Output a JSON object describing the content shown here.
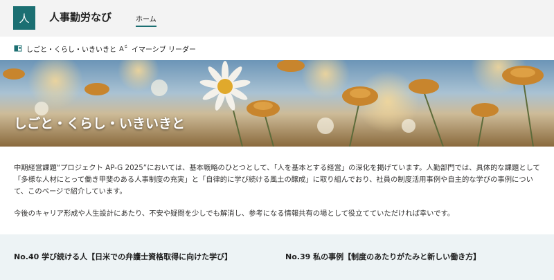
{
  "header": {
    "logo_text": "人",
    "site_title": "人事勤労なび",
    "nav_home": "ホーム"
  },
  "commandbar": {
    "items": [
      {
        "label": "しごと・くらし・いきいきと",
        "icon": "page-icon"
      },
      {
        "label": "イマーシブ リーダー",
        "icon": "immersive-reader-icon"
      }
    ]
  },
  "hero": {
    "title": "しごと・くらし・いきいきと"
  },
  "intro": {
    "paragraph1": "中期経営課題“プロジェクト AP-G 2025”においては、基本戦略のひとつとして、「人を基本とする経営」の深化を掲げています。人勤部門では、具体的な課題として「多様な人材にとって働き甲斐のある人事制度の充実」と「自律的に学び続ける風土の醸成」に取り組んでおり、社員の制度活用事例や自主的な学びの事例について、このページで紹介しています。",
    "paragraph2": "今後のキャリア形成や人生設計にあたり、不安や疑問を少しでも解消し、参考になる情報共有の場として役立てていただければ幸いです。"
  },
  "cards": [
    {
      "title": "No.40 学び続ける人【日米での弁護士資格取得に向けた学び】"
    },
    {
      "title": "No.39 私の事例【制度のあたりがたみと新しい働き方】"
    }
  ],
  "colors": {
    "accent": "#1b6f72",
    "header_bg": "#f3f3f3",
    "cards_bg": "#edf3f5"
  }
}
